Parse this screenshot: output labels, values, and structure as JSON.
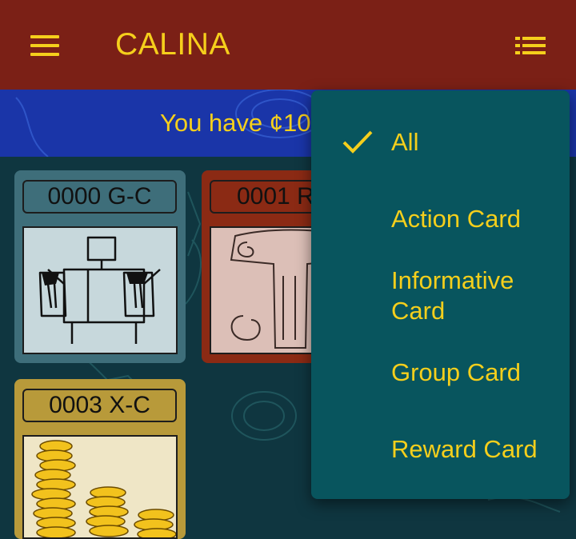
{
  "app": {
    "title": "CALINA"
  },
  "icons": {
    "menu": "hamburger-menu-icon",
    "list": "list-view-icon",
    "check": "checkmark-icon"
  },
  "colors": {
    "topbar": "#7b2016",
    "accent": "#f5cf1c",
    "banner": "#1a35a8",
    "background": "#0f3640",
    "dropdown": "#08555e"
  },
  "banner": {
    "text": "You have ¢10"
  },
  "cards": [
    {
      "code": "0000 G-C",
      "color": "#3e6e7a"
    },
    {
      "code": "0001 R",
      "color": "#8b2a14"
    },
    {
      "code": "0003 X-C",
      "color": "#b89a3a"
    }
  ],
  "filter_menu": {
    "selected": "All",
    "items": [
      {
        "label": "All"
      },
      {
        "label": "Action Card"
      },
      {
        "label": "Informative Card"
      },
      {
        "label": "Group Card"
      },
      {
        "label": "Reward Card"
      }
    ]
  }
}
